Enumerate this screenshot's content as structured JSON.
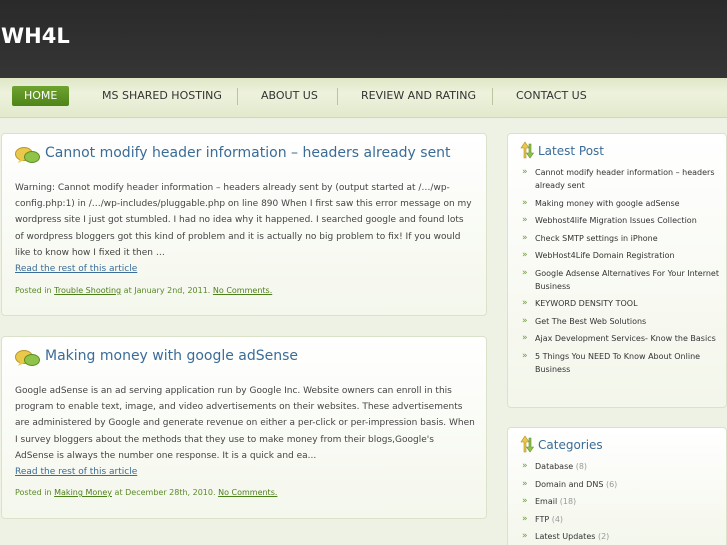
{
  "site": {
    "title": "WH4L"
  },
  "nav": {
    "items": [
      {
        "label": "HOME",
        "active": true
      },
      {
        "label": "MS SHARED HOSTING",
        "active": false
      },
      {
        "label": "ABOUT US",
        "active": false
      },
      {
        "label": "REVIEW AND RATING",
        "active": false
      },
      {
        "label": "CONTACT US",
        "active": false
      }
    ]
  },
  "posts": [
    {
      "title": "Cannot modify header information – headers already sent",
      "excerpt": "Warning: Cannot modify header information – headers already sent by (output started at /…/wp-config.php:1) in /…/wp-includes/pluggable.php on line 890 When I first saw this error message on my wordpress site I just got stumbled. I had no idea why it happened. I searched google and found lots of wordpress bloggers got this kind of problem and it is actually no big problem to fix! If you would like to know how I fixed it then …",
      "read_more": "Read the rest of this article",
      "meta": {
        "posted_in": "Posted in",
        "category": "Trouble Shooting",
        "at": "at January 2nd, 2011.",
        "comments": "No Comments."
      }
    },
    {
      "title": "Making money with google adSense",
      "excerpt": "Google adSense is an ad serving application run by Google Inc. Website owners can enroll in this program to enable text, image, and video advertisements on their websites. These advertisements are administered by Google and generate revenue on either a per-click or per-impression basis. When I survey bloggers about the methods that they use to make money from their blogs,Google's AdSense is always the number one response. It is a quick and ea...",
      "read_more": "Read the rest of this article",
      "meta": {
        "posted_in": "Posted in",
        "category": "Making Money",
        "at": "at December 28th, 2010.",
        "comments": "No Comments."
      }
    }
  ],
  "sidebar": {
    "latest": {
      "title": "Latest Post",
      "items": [
        "Cannot modify header information – headers already sent",
        "Making money with google adSense",
        "Webhost4life Migration Issues Collection",
        "Check SMTP settings in iPhone",
        "WebHost4Life Domain Registration",
        "Google Adsense Alternatives For Your Internet Business",
        "KEYWORD DENSITY TOOL",
        "Get The Best Web Solutions",
        "Ajax Development Services- Know the Basics",
        "5 Things You NEED To Know About Online Business"
      ]
    },
    "categories": {
      "title": "Categories",
      "items": [
        {
          "name": "Database",
          "count": "(8)"
        },
        {
          "name": "Domain and DNS",
          "count": "(6)"
        },
        {
          "name": "Email",
          "count": "(18)"
        },
        {
          "name": "FTP",
          "count": "(4)"
        },
        {
          "name": "Latest Updates",
          "count": "(2)"
        }
      ]
    }
  },
  "colors": {
    "accent": "#3a6c98",
    "nav_active": "#5a9222",
    "header_bg": "#2f2f2f",
    "page_bg": "#eef2e4"
  },
  "icons": {
    "post": "speech-bubbles-icon",
    "widget": "arrows-icon"
  }
}
